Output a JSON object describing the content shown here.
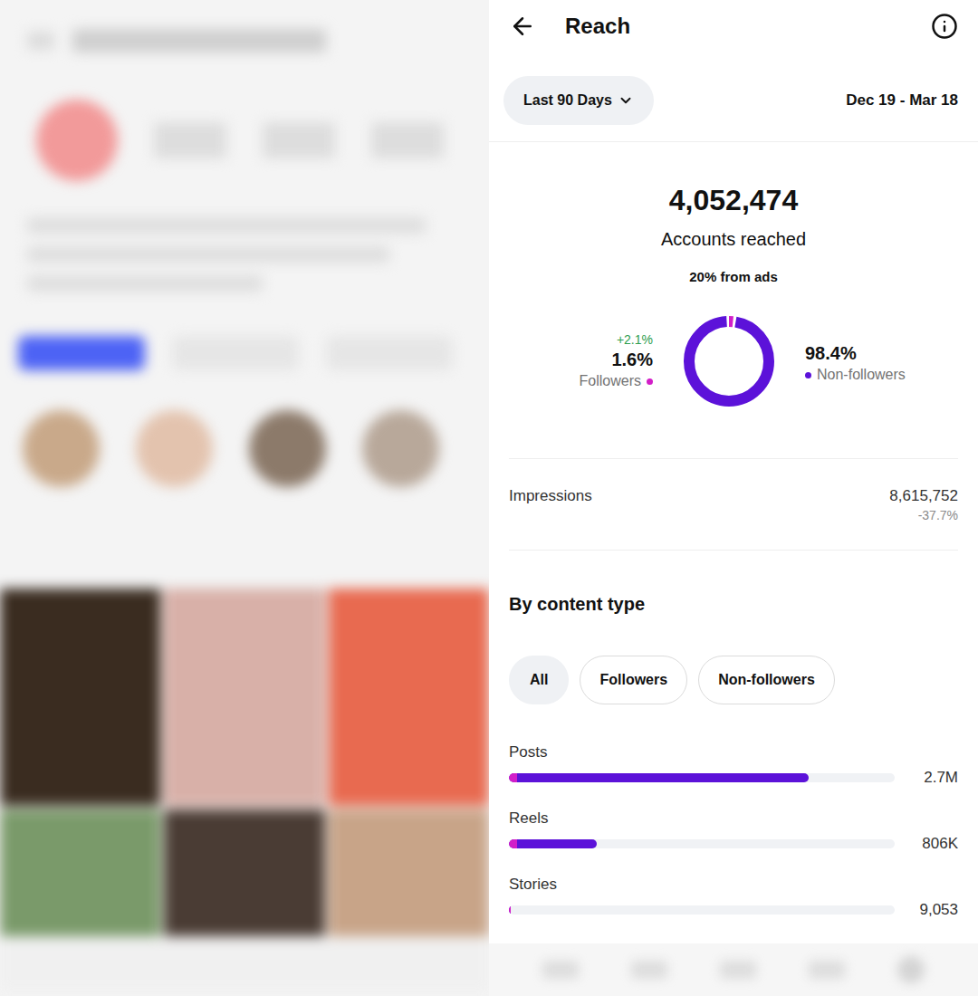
{
  "header": {
    "title": "Reach"
  },
  "filter": {
    "label": "Last 90 Days",
    "date_range": "Dec 19 - Mar 18"
  },
  "summary": {
    "total": "4,052,474",
    "label": "Accounts reached",
    "ads_note": "20% from ads"
  },
  "audience": {
    "followers": {
      "label": "Followers",
      "percent": "1.6%",
      "change": "+2.1%",
      "share": 0.016,
      "color": "#d21ec8"
    },
    "non_followers": {
      "label": "Non-followers",
      "percent": "98.4%",
      "share": 0.984,
      "color": "#5c12d9"
    }
  },
  "impressions": {
    "label": "Impressions",
    "value": "8,615,752",
    "change": "-37.7%"
  },
  "content_type": {
    "title": "By content type",
    "filters": [
      {
        "label": "All",
        "selected": true
      },
      {
        "label": "Followers",
        "selected": false
      },
      {
        "label": "Non-followers",
        "selected": false
      }
    ],
    "rows": [
      {
        "label": "Posts",
        "value": "2.7M",
        "level": 0.777,
        "followers_level": 0.02
      },
      {
        "label": "Reels",
        "value": "806K",
        "level": 0.228,
        "followers_level": 0.02
      },
      {
        "label": "Stories",
        "value": "9,053",
        "level": 0.004,
        "followers_level": 0.004
      }
    ]
  }
}
